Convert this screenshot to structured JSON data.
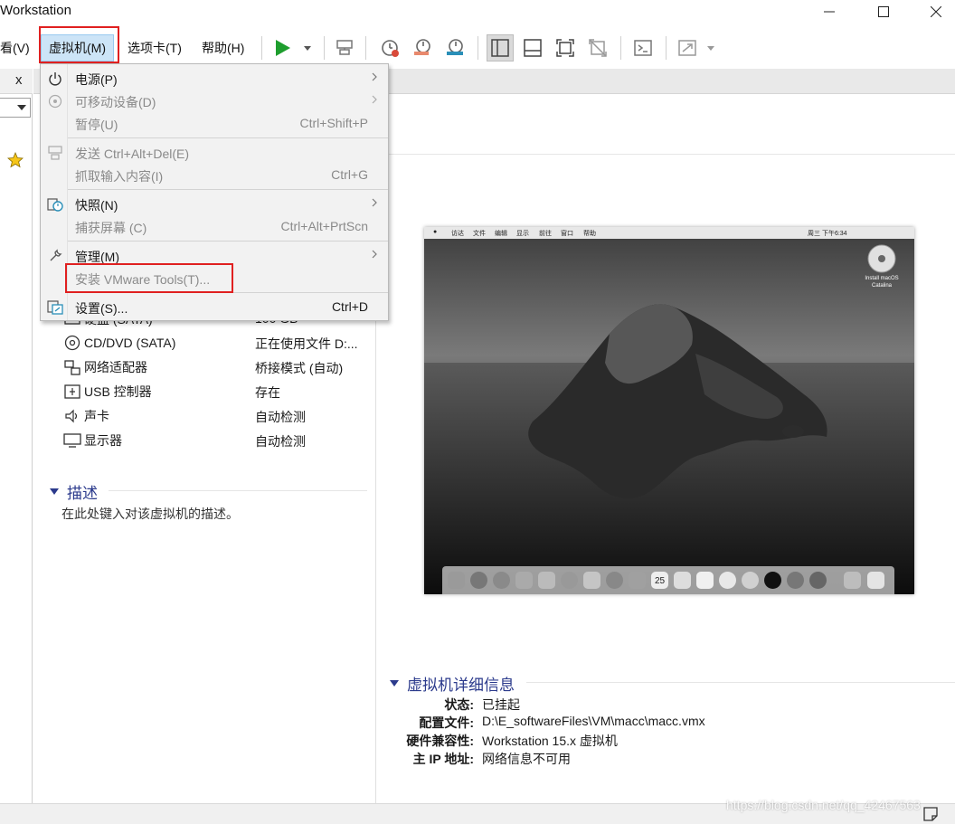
{
  "window": {
    "title": "Workstation"
  },
  "menubar": {
    "view": "看(V)",
    "vm": "虚拟机(M)",
    "tabs": "选项卡(T)",
    "help": "帮助(H)"
  },
  "vm_menu": {
    "items": [
      {
        "label": "电源(P)",
        "shortcut": "",
        "submenu": true,
        "enabled": true,
        "icon": "power-icon"
      },
      {
        "label": "可移动设备(D)",
        "shortcut": "",
        "submenu": true,
        "enabled": false,
        "icon": "disc-icon"
      },
      {
        "label": "暂停(U)",
        "shortcut": "Ctrl+Shift+P",
        "submenu": false,
        "enabled": false,
        "icon": ""
      },
      {
        "label": "发送 Ctrl+Alt+Del(E)",
        "shortcut": "",
        "submenu": false,
        "enabled": false,
        "icon": "send-keys-icon"
      },
      {
        "label": "抓取输入内容(I)",
        "shortcut": "Ctrl+G",
        "submenu": false,
        "enabled": false,
        "icon": ""
      },
      {
        "label": "快照(N)",
        "shortcut": "",
        "submenu": true,
        "enabled": true,
        "icon": "snapshot-icon"
      },
      {
        "label": "捕获屏幕 (C)",
        "shortcut": "Ctrl+Alt+PrtScn",
        "submenu": false,
        "enabled": false,
        "icon": ""
      },
      {
        "label": "管理(M)",
        "shortcut": "",
        "submenu": true,
        "enabled": true,
        "icon": "wrench-icon"
      },
      {
        "label": "安装 VMware Tools(T)...",
        "shortcut": "",
        "submenu": false,
        "enabled": false,
        "icon": ""
      },
      {
        "label": "设置(S)...",
        "shortcut": "Ctrl+D",
        "submenu": false,
        "enabled": true,
        "icon": "settings-icon"
      }
    ]
  },
  "devices": [
    {
      "name": "硬盘 (SATA)",
      "value": "100 GB",
      "icon": "harddisk-icon"
    },
    {
      "name": "CD/DVD (SATA)",
      "value": "正在使用文件 D:...",
      "icon": "cd-icon"
    },
    {
      "name": "网络适配器",
      "value": "桥接模式 (自动)",
      "icon": "network-icon"
    },
    {
      "name": "USB 控制器",
      "value": "存在",
      "icon": "usb-icon"
    },
    {
      "name": "声卡",
      "value": "自动检测",
      "icon": "speaker-icon"
    },
    {
      "name": "显示器",
      "value": "自动检测",
      "icon": "monitor-icon"
    }
  ],
  "description": {
    "title": "描述",
    "placeholder": "在此处键入对该虚拟机的描述。"
  },
  "details": {
    "title": "虚拟机详细信息",
    "rows": [
      {
        "key": "状态:",
        "value": "已挂起"
      },
      {
        "key": "配置文件:",
        "value": "D:\\E_softwareFiles\\VM\\macc\\macc.vmx"
      },
      {
        "key": "硬件兼容性:",
        "value": "Workstation 15.x 虚拟机"
      },
      {
        "key": "主 IP 地址:",
        "value": "网络信息不可用"
      }
    ]
  },
  "thumbnail": {
    "menubar": [
      "访达",
      "文件",
      "编辑",
      "显示",
      "前往",
      "窗口",
      "帮助"
    ],
    "clock": "周三 下午6:34",
    "desktop_icon_label_1": "Install macOS",
    "desktop_icon_label_2": "Catalina",
    "calendar_day": "25"
  },
  "left_panel": {
    "close": "x"
  },
  "watermark": "https://blog.csdn.net/qq_42467563",
  "colors": {
    "accent": "#2b3a8c",
    "highlight": "#cce4f7",
    "annotation": "#e02020",
    "play": "#1e9e2e"
  }
}
